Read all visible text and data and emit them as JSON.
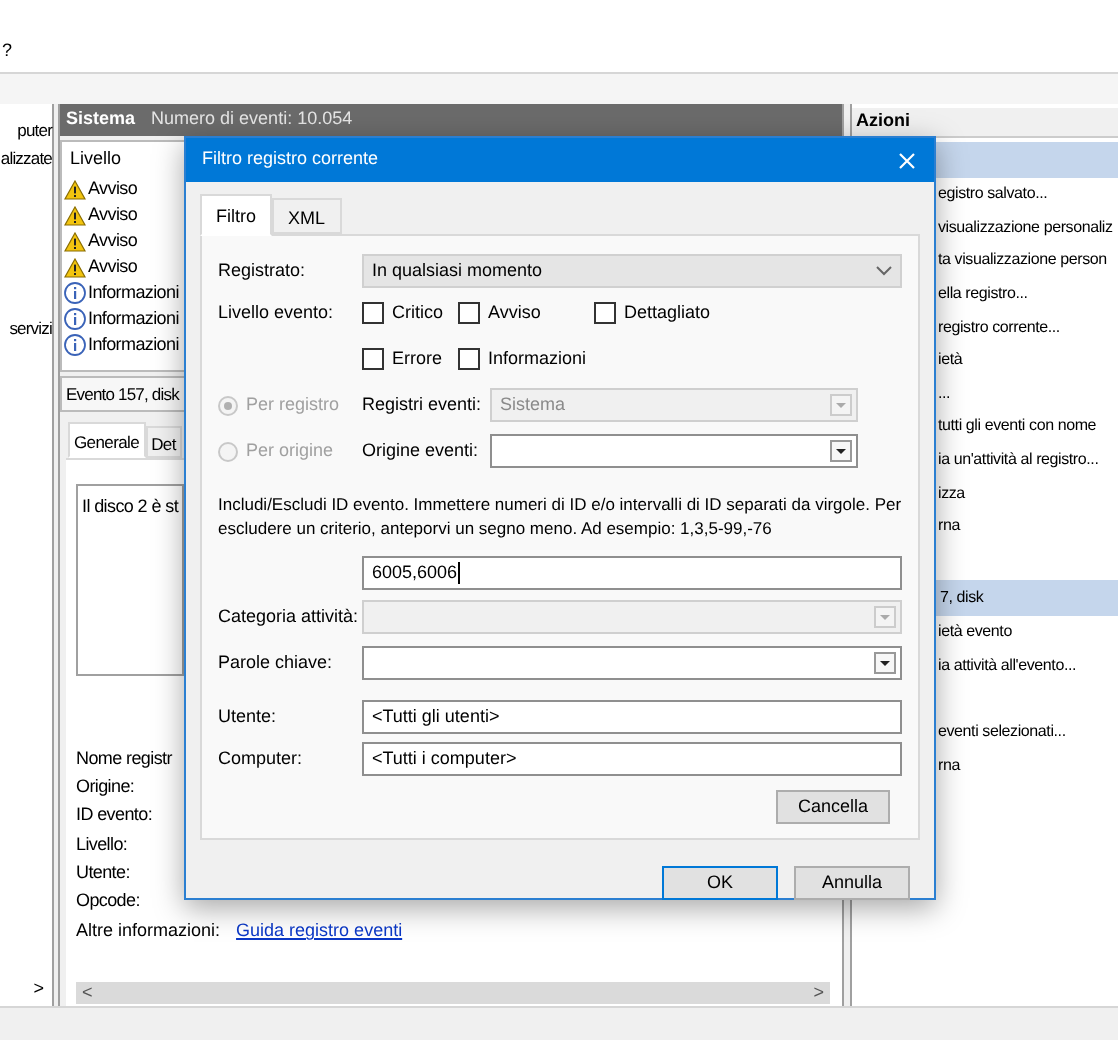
{
  "menu_bar": {
    "items": [
      "?"
    ]
  },
  "navigation_pane": {
    "items": [
      "puter",
      "alizzate",
      "servizi"
    ],
    "scroll_arrow": ">"
  },
  "log_header": {
    "title": "Sistema",
    "event_count": "Numero di eventi: 10.054"
  },
  "events_table": {
    "columns": [
      "Livello"
    ],
    "rows": [
      {
        "kind": "warning",
        "level": "Avviso"
      },
      {
        "kind": "warning",
        "level": "Avviso"
      },
      {
        "kind": "warning",
        "level": "Avviso"
      },
      {
        "kind": "warning",
        "level": "Avviso"
      },
      {
        "kind": "info",
        "level": "Informazioni"
      },
      {
        "kind": "info",
        "level": "Informazioni"
      },
      {
        "kind": "info",
        "level": "Informazioni"
      }
    ]
  },
  "event_details": {
    "title": "Evento 157, disk",
    "tabs": [
      {
        "label": "Generale",
        "selected": true
      },
      {
        "label": "Det",
        "selected": false
      }
    ],
    "description": "Il disco 2 è st",
    "fields": [
      "Nome registr",
      "Origine:",
      "ID evento:",
      "Livello:",
      "Utente:",
      "Opcode:"
    ],
    "more_info": {
      "label": "Altre informazioni:",
      "link": "Guida registro eventi"
    },
    "scroll_left": "<",
    "scroll_right": ">"
  },
  "actions_pane": {
    "title": "Azioni",
    "items": [
      {
        "kind": "group"
      },
      {
        "kind": "action",
        "label": "egistro salvato..."
      },
      {
        "kind": "action",
        "label": "visualizzazione personaliz"
      },
      {
        "kind": "action",
        "label": "ta visualizzazione person"
      },
      {
        "kind": "action",
        "label": "ella registro..."
      },
      {
        "kind": "action",
        "label": "registro corrente..."
      },
      {
        "kind": "action",
        "label": "ietà"
      },
      {
        "kind": "action",
        "label": "..."
      },
      {
        "kind": "action",
        "label": "tutti gli eventi con nome"
      },
      {
        "kind": "action",
        "label": "ia un'attività al registro..."
      },
      {
        "kind": "action",
        "label": "izza"
      },
      {
        "kind": "action",
        "label": "rna"
      },
      {
        "kind": "spacer"
      },
      {
        "kind": "group",
        "label": "7, disk"
      },
      {
        "kind": "action",
        "label": "ietà evento"
      },
      {
        "kind": "action",
        "label": "ia attività all'evento..."
      },
      {
        "kind": "spacer"
      },
      {
        "kind": "action",
        "label": "eventi selezionati..."
      },
      {
        "kind": "action",
        "label": "rna"
      }
    ]
  },
  "dialog": {
    "title": "Filtro registro corrente",
    "tabs": [
      {
        "label": "Filtro",
        "selected": true
      },
      {
        "label": "XML",
        "selected": false
      }
    ],
    "logged": {
      "label": "Registrato:",
      "value": "In qualsiasi momento"
    },
    "event_level": {
      "label": "Livello evento:",
      "options": [
        {
          "label": "Critico",
          "checked": false
        },
        {
          "label": "Avviso",
          "checked": false
        },
        {
          "label": "Dettagliato",
          "checked": false
        },
        {
          "label": "Errore",
          "checked": false
        },
        {
          "label": "Informazioni",
          "checked": false
        }
      ]
    },
    "source_mode": [
      {
        "label": "Per registro",
        "selected": true,
        "disabled": true,
        "field_label": "Registri eventi:",
        "value": "Sistema",
        "field_disabled": true
      },
      {
        "label": "Per origine",
        "selected": false,
        "disabled": true,
        "field_label": "Origine eventi:",
        "field_disabled": false
      }
    ],
    "id_help": "Includi/Escludi ID evento. Immettere numeri di ID e/o intervalli di ID separati da virgole. Per escludere un criterio, anteporvi un segno meno. Ad esempio: 1,3,5-99,-76",
    "event_ids": {
      "value": "6005,6006"
    },
    "task_category": {
      "label": "Categoria attività:",
      "disabled": true
    },
    "keywords": {
      "label": "Parole chiave:",
      "disabled": false
    },
    "user": {
      "label": "Utente:",
      "value": "<Tutti gli utenti>"
    },
    "computer": {
      "label": "Computer:",
      "value": "<Tutti i computer>"
    },
    "buttons": {
      "clear": "Cancella",
      "ok": "OK",
      "cancel": "Annulla"
    }
  }
}
